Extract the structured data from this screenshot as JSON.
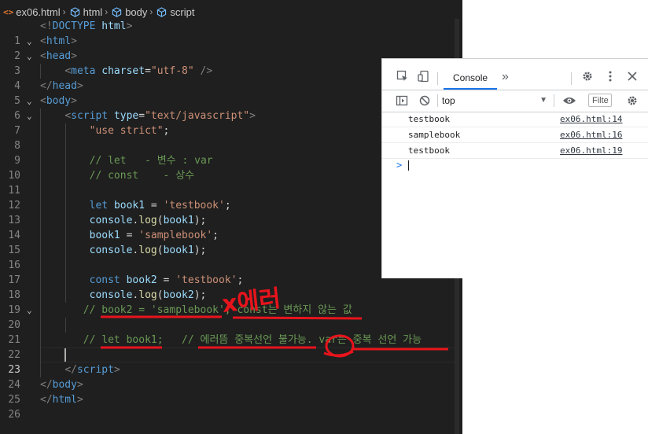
{
  "breadcrumb": {
    "file_icon": "<>",
    "file": "ex06.html",
    "items": [
      "html",
      "body",
      "script"
    ]
  },
  "editor": {
    "lines": [
      {
        "n": "1",
        "fold": ""
      },
      {
        "n": "2",
        "fold": "v"
      },
      {
        "n": "3",
        "fold": "v"
      },
      {
        "n": "4",
        "fold": ""
      },
      {
        "n": "5",
        "fold": ""
      },
      {
        "n": "6",
        "fold": "v"
      },
      {
        "n": "7",
        "fold": "v"
      },
      {
        "n": "8",
        "fold": ""
      },
      {
        "n": "9",
        "fold": ""
      },
      {
        "n": "10",
        "fold": ""
      },
      {
        "n": "11",
        "fold": ""
      },
      {
        "n": "12",
        "fold": ""
      },
      {
        "n": "13",
        "fold": ""
      },
      {
        "n": "14",
        "fold": ""
      },
      {
        "n": "15",
        "fold": ""
      },
      {
        "n": "16",
        "fold": ""
      },
      {
        "n": "17",
        "fold": ""
      },
      {
        "n": "18",
        "fold": ""
      },
      {
        "n": "19",
        "fold": ""
      },
      {
        "n": "20",
        "fold": "v"
      },
      {
        "n": "21",
        "fold": ""
      },
      {
        "n": "22",
        "fold": ""
      },
      {
        "n": "23",
        "fold": ""
      },
      {
        "n": "24",
        "fold": ""
      },
      {
        "n": "25",
        "fold": ""
      },
      {
        "n": "26",
        "fold": ""
      }
    ],
    "code": {
      "l1": {
        "a": "<!",
        "b": "DOCTYPE",
        "c": "html",
        "d": ">"
      },
      "l2": {
        "a": "<",
        "b": "html",
        "c": ">"
      },
      "l3": {
        "a": "<",
        "b": "head",
        "c": ">"
      },
      "l4": {
        "a": "<",
        "b": "meta",
        "attr": "charset",
        "eq": "=",
        "val": "\"utf-8\"",
        "end": " />"
      },
      "l5": {
        "a": "</",
        "b": "head",
        "c": ">"
      },
      "l6": {
        "a": "<",
        "b": "body",
        "c": ">"
      },
      "l7": {
        "a": "<",
        "b": "script",
        "attr": "type",
        "eq": "=",
        "val": "\"text/javascript\"",
        "c": ">"
      },
      "l8": "\"use strict\"",
      "l8_end": ";",
      "l10": "// let   - 변수 : var",
      "l11": "// const    - 상수",
      "l13": {
        "kw": "let",
        "v": "book1",
        "eq": " = ",
        "s": "'testbook'",
        "e": ";"
      },
      "l14": {
        "o": "console",
        "dot": ".",
        "f": "log",
        "p1": "(",
        "v": "book1",
        "p2": ");"
      },
      "l15": {
        "v": "book1",
        "eq": " = ",
        "s": "'samplebook'",
        "e": ";"
      },
      "l16": {
        "o": "console",
        "dot": ".",
        "f": "log",
        "p1": "(",
        "v": "book1",
        "p2": ");"
      },
      "l18": {
        "kw": "const",
        "v": "book2",
        "eq": " = ",
        "s": "'testbook'",
        "e": ";"
      },
      "l19": {
        "o": "console",
        "dot": ".",
        "f": "log",
        "p1": "(",
        "v": "book2",
        "p2": ");"
      },
      "l20": "// book2 = 'samplebook'; const는 변하지 않는 값",
      "l22": "// let book1;   // 에러뜸 중복선언 불가능. var는 중복 선언 가능",
      "l24": {
        "a": "</",
        "b": "script",
        "c": ">"
      },
      "l25": {
        "a": "</",
        "b": "body",
        "c": ">"
      },
      "l26": {
        "a": "</",
        "b": "html",
        "c": ">"
      }
    }
  },
  "annotation": {
    "text": "x에러",
    "color": "#e8141c"
  },
  "devtools": {
    "tab_console": "Console",
    "more_tabs": "»",
    "context": "top",
    "filter_placeholder": "Filte",
    "logs": [
      {
        "msg": "testbook",
        "src": "ex06.html:14"
      },
      {
        "msg": "samplebook",
        "src": "ex06.html:16"
      },
      {
        "msg": "testbook",
        "src": "ex06.html:19"
      }
    ],
    "prompt": ">"
  }
}
